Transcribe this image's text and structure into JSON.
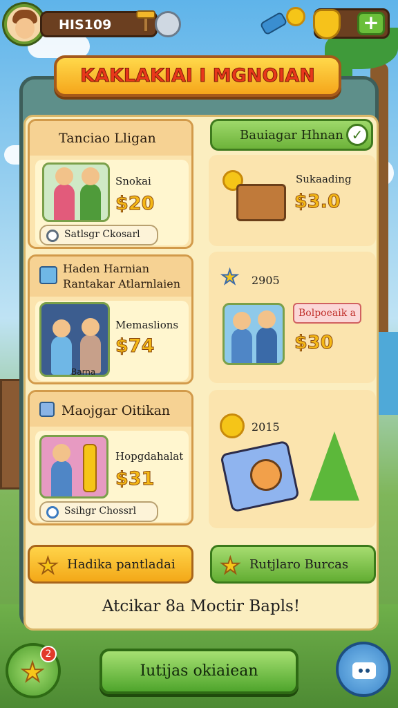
{
  "player": {
    "name": "HIS109"
  },
  "title": "KAKLAKIAI I MGNOIAN",
  "left_cards": [
    {
      "title": "Tanciao Lligan",
      "item_name": "Snokai",
      "price": "$20",
      "button_label": "Satlsgr Ckosarl"
    },
    {
      "title_line1": "Haden Harnian",
      "title_line2": "Rantakar Atlarnlaien",
      "item_name": "Memaslions",
      "price": "$74",
      "caption": "Barna"
    },
    {
      "title": "Maojgar Oitikan",
      "item_name": "Hopgdahalat",
      "price": "$31",
      "button_label": "Ssihgr Chossrl"
    }
  ],
  "right_column": {
    "header": "Bauiagar Hhnan",
    "cells": [
      {
        "item_name": "Sukaading",
        "price": "$3.0"
      },
      {
        "year": "2905",
        "tag_label": "Bolpoeaik a",
        "price": "$30"
      },
      {
        "year": "2015"
      }
    ]
  },
  "buttons": {
    "yellow_label": "Hadika pantladai",
    "green_label": "Rutjlaro Burcas",
    "main_cta": "Iutijas okiaiean"
  },
  "footer_text": "Atcikar 8a Moctir Bapls!",
  "badges": {
    "notification": "2"
  },
  "colors": {
    "accent": "#f5b815",
    "primary_green": "#62ad32",
    "banner_text": "#e8381b"
  },
  "icons": [
    "avatar",
    "hammer-icon",
    "clock-icon",
    "telescope-icon",
    "coin-icon",
    "shield-icon",
    "plus-icon",
    "gift-icon",
    "check-icon",
    "star-icon",
    "chat-icon"
  ]
}
